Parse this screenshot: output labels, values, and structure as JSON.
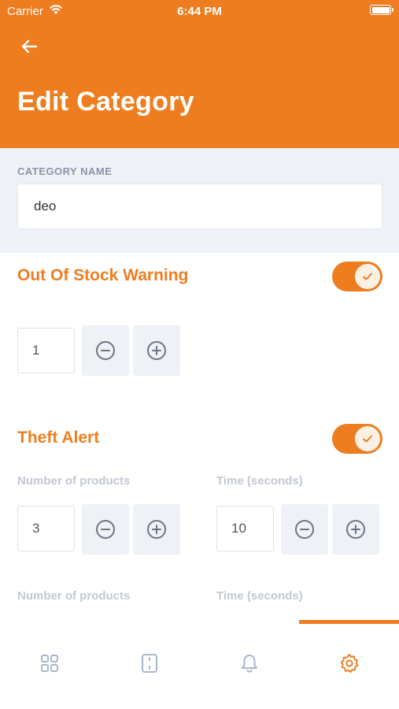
{
  "status_bar": {
    "carrier": "Carrier",
    "time": "6:44 PM"
  },
  "header": {
    "title": "Edit Category",
    "back_icon": "arrow-left-icon"
  },
  "category": {
    "label": "CATEGORY NAME",
    "value": "deo"
  },
  "out_of_stock": {
    "title": "Out Of Stock Warning",
    "enabled": true,
    "value": "1"
  },
  "theft_alert": {
    "title": "Theft Alert",
    "enabled": true,
    "rows": [
      {
        "products_label": "Number of products",
        "time_label": "Time (seconds)",
        "products_value": "3",
        "time_value": "10"
      },
      {
        "products_label": "Number of products",
        "time_label": "Time (seconds)"
      }
    ]
  },
  "tabs": [
    {
      "icon": "grid-icon",
      "active": false
    },
    {
      "icon": "device-icon",
      "active": false
    },
    {
      "icon": "bell-icon",
      "active": false
    },
    {
      "icon": "gear-icon",
      "active": true
    }
  ],
  "colors": {
    "accent": "#EE7D20",
    "muted": "#C3C8D2",
    "panel": "#EEF1F6",
    "icon_inactive": "#A9B6CD"
  }
}
